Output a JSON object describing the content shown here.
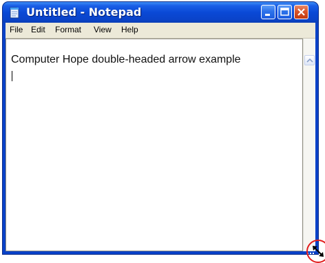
{
  "window": {
    "title": "Untitled - Notepad",
    "icon": "notepad-icon"
  },
  "titlebar_buttons": {
    "minimize_icon": "minimize-icon",
    "maximize_icon": "maximize-icon",
    "close_icon": "close-icon"
  },
  "menu": {
    "items": [
      {
        "label": "File"
      },
      {
        "label": "Edit"
      },
      {
        "label": "Format"
      },
      {
        "label": "View"
      },
      {
        "label": "Help"
      }
    ]
  },
  "editor": {
    "text": "Computer Hope double-headed arrow example"
  },
  "scrollbar": {
    "up_icon": "chevron-up-icon"
  },
  "annotation": {
    "cursor_icon": "double-headed-arrow-icon",
    "ring_color": "#e11b1b"
  }
}
